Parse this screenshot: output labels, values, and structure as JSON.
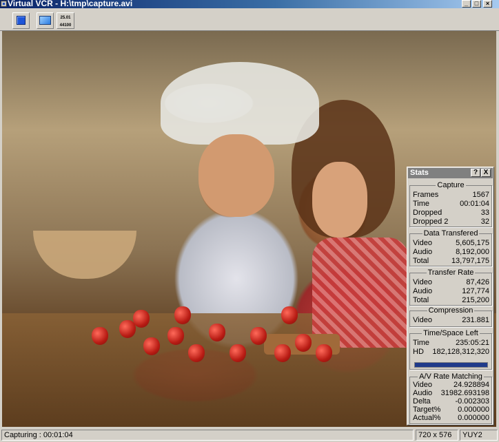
{
  "window": {
    "title": "Virtual VCR - H:\\tmp\\capture.avi",
    "minimize_icon": "minimize-icon",
    "maximize_icon": "maximize-icon",
    "close_icon": "close-icon"
  },
  "toolbar": {
    "stop_icon": "stop-icon",
    "monitor_icon": "monitor-icon",
    "info_line1": "25.01",
    "info_line2": "44100"
  },
  "stats": {
    "title": "Stats",
    "help_label": "?",
    "close_label": "X",
    "capture": {
      "label": "Capture",
      "rows": [
        {
          "label": "Frames",
          "value": "1567"
        },
        {
          "label": "Time",
          "value": "00:01:04"
        },
        {
          "label": "Dropped",
          "value": "33"
        },
        {
          "label": "Dropped 2",
          "value": "32"
        }
      ]
    },
    "data_transfered": {
      "label": "Data Transfered",
      "rows": [
        {
          "label": "Video",
          "value": "5,605,175"
        },
        {
          "label": "Audio",
          "value": "8,192,000"
        },
        {
          "label": "Total",
          "value": "13,797,175"
        }
      ]
    },
    "transfer_rate": {
      "label": "Transfer Rate",
      "rows": [
        {
          "label": "Video",
          "value": "87,426"
        },
        {
          "label": "Audio",
          "value": "127,774"
        },
        {
          "label": "Total",
          "value": "215,200"
        }
      ]
    },
    "compression": {
      "label": "Compression",
      "rows": [
        {
          "label": "Video",
          "value": "231.881"
        }
      ]
    },
    "time_space_left": {
      "label": "Time/Space Left",
      "rows": [
        {
          "label": "Time",
          "value": "235:05:21"
        },
        {
          "label": "HD",
          "value": "182,128,312,320"
        }
      ],
      "hd_fill_fraction": 1.0
    },
    "av_rate_matching": {
      "label": "A/V Rate Matching",
      "rows": [
        {
          "label": "Video",
          "value": "24.928894"
        },
        {
          "label": "Audio",
          "value": "31982.693198"
        },
        {
          "label": "Delta",
          "value": "-0.002303"
        },
        {
          "label": "Target%",
          "value": "0.000000"
        },
        {
          "label": "Actual%",
          "value": "0.000000"
        }
      ]
    }
  },
  "statusbar": {
    "status": "Capturing : 00:01:04",
    "resolution": "720 x 576",
    "format": "YUY2"
  },
  "colors": {
    "title_active": "#0a246a",
    "face": "#d4d0c8",
    "stats_title": "#808080",
    "hd_bar": "#1f3a8a"
  }
}
